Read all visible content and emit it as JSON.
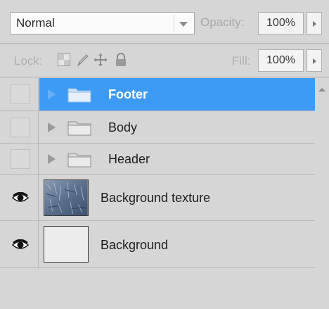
{
  "blend_mode": {
    "value": "Normal"
  },
  "opacity": {
    "label": "Opacity:",
    "value": "100%"
  },
  "lock": {
    "label": "Lock:",
    "icons": [
      "lock-transparent-pixels-icon",
      "lock-image-pixels-icon",
      "lock-position-icon",
      "lock-all-icon"
    ]
  },
  "fill": {
    "label": "Fill:",
    "value": "100%"
  },
  "layers": [
    {
      "name": "Footer",
      "type": "group",
      "visible": false,
      "selected": true
    },
    {
      "name": "Body",
      "type": "group",
      "visible": false,
      "selected": false
    },
    {
      "name": "Header",
      "type": "group",
      "visible": false,
      "selected": false
    },
    {
      "name": "Background texture",
      "type": "image",
      "visible": true,
      "selected": false
    },
    {
      "name": "Background",
      "type": "image",
      "visible": true,
      "selected": false
    }
  ],
  "colors": {
    "selection": "#3d9bf6",
    "panel": "#d6d6d6"
  }
}
